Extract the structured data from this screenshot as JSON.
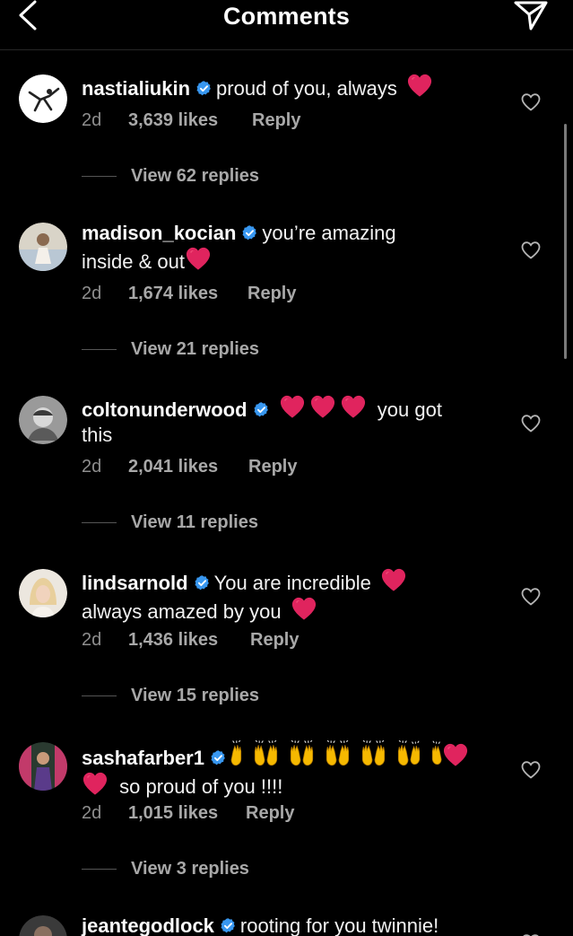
{
  "header": {
    "title": "Comments"
  },
  "comments": [
    {
      "username": "nastialiukin",
      "text_lines": [
        "proud of you, always"
      ],
      "time": "2d",
      "likes": "3,639 likes",
      "reply": "Reply",
      "view_replies": "View 62 replies"
    },
    {
      "username": "madison_kocian",
      "text_lines": [
        "you’re amazing",
        "inside & out"
      ],
      "time": "2d",
      "likes": "1,674 likes",
      "reply": "Reply",
      "view_replies": "View 21 replies"
    },
    {
      "username": "coltonunderwood",
      "text_lines": [
        "you got",
        "this"
      ],
      "time": "2d",
      "likes": "2,041 likes",
      "reply": "Reply",
      "view_replies": "View 11 replies"
    },
    {
      "username": "lindsarnold",
      "text_lines": [
        "You are incredible",
        "always amazed by you"
      ],
      "time": "2d",
      "likes": "1,436 likes",
      "reply": "Reply",
      "view_replies": "View 15 replies"
    },
    {
      "username": "sashafarber1",
      "text_lines": [
        "so proud of you !!!!"
      ],
      "time": "2d",
      "likes": "1,015 likes",
      "reply": "Reply",
      "view_replies": "View 3 replies"
    },
    {
      "username": "jeantegodlock",
      "text_lines": [
        "rooting for you twinnie!"
      ]
    }
  ],
  "icons": {
    "back": "chevron-left-icon",
    "share": "paper-plane-icon",
    "verified": "verified-badge-icon",
    "like": "heart-outline-icon",
    "emoji_heart": "red-heart-emoji",
    "emoji_hands": "raising-hands-emoji"
  },
  "colors": {
    "background": "#000000",
    "verified": "#3897f0",
    "heart_emoji": "#e0245e",
    "secondary_text": "#8e8e8e"
  }
}
